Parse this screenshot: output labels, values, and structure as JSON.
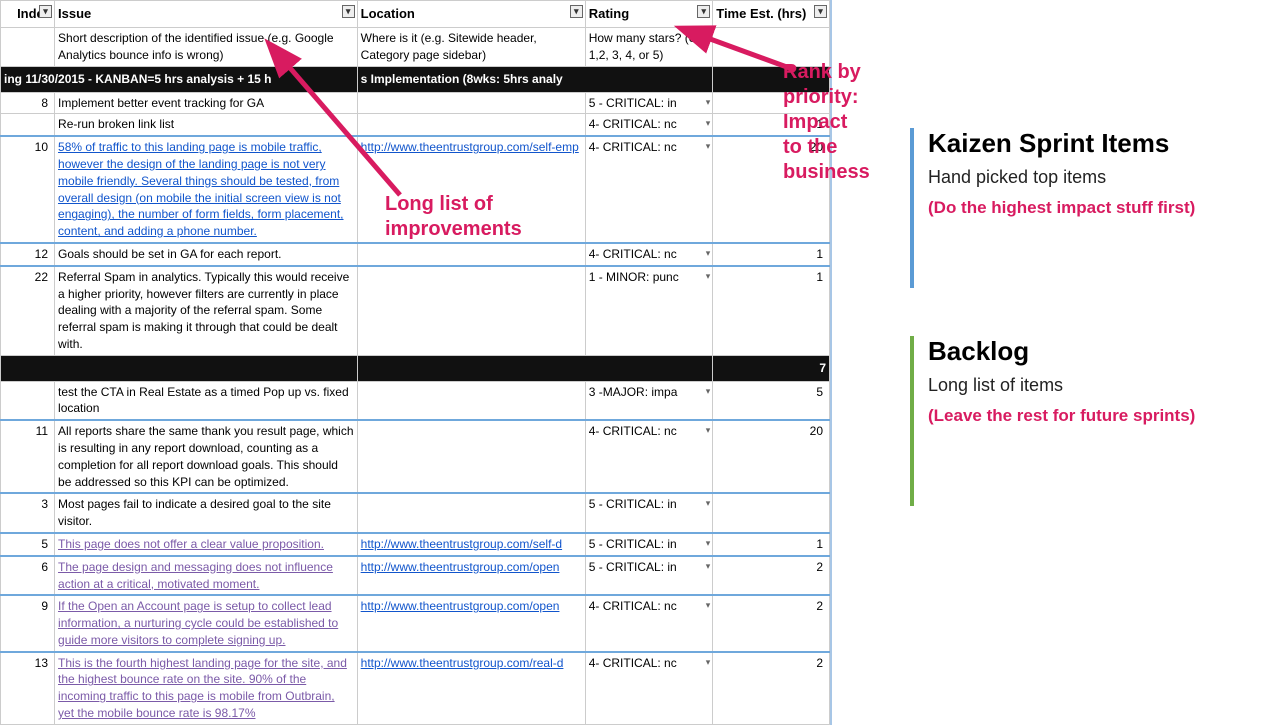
{
  "columns": {
    "index": "Index",
    "issue": "Issue",
    "location": "Location",
    "rating": "Rating",
    "time": "Time Est. (hrs)"
  },
  "hints": {
    "issue": "Short description of the identified issue (e.g. Google Analytics bounce info is wrong)",
    "location": "Where is it (e.g. Sitewide header, Category page sidebar)",
    "rating": "How many stars? (e.g. 1,2, 3, 4, or 5)"
  },
  "group1": {
    "header_left": "ing 11/30/2015 - KANBAN=5 hrs analysis + 15 h",
    "header_mid": "s Implementation (8wks: 5hrs analy",
    "rows": [
      {
        "index": "8",
        "issue": "Implement better event tracking for GA",
        "issue_link": false,
        "location": "",
        "rating": "5 - CRITICAL: in",
        "time": ""
      },
      {
        "index": "",
        "issue": "Re-run broken link list",
        "issue_link": false,
        "location": "",
        "rating": "4- CRITICAL: nc",
        "time": "1"
      },
      {
        "index": "10",
        "issue": "58% of traffic to this landing page is mobile traffic, however the design of the landing page is not very mobile friendly. Several things should be tested, from overall design (on mobile the initial screen view is not engaging), the number of form fields, form placement, content, and adding a phone number.",
        "issue_link": true,
        "location": "http://www.theentrustgroup.com/self-emp",
        "location_link": true,
        "rating": "4- CRITICAL: nc",
        "time": "20"
      },
      {
        "index": "12",
        "issue": "Goals should be set in GA for each report.",
        "issue_link": false,
        "location": "",
        "rating": "4- CRITICAL: nc",
        "time": "1"
      },
      {
        "index": "22",
        "issue": "Referral Spam in analytics. Typically this would receive a higher priority, however filters are currently in place dealing with a majority of the referral spam. Some referral spam is making it through that could be dealt with.",
        "issue_link": false,
        "location": "",
        "rating": "1 - MINOR: punc",
        "time": "1"
      }
    ]
  },
  "group2": {
    "total": "7",
    "rows": [
      {
        "index": "",
        "issue": "test the CTA in Real Estate as a timed Pop up vs. fixed location",
        "issue_link": false,
        "location": "",
        "rating": "3 -MAJOR: impa",
        "time": "5"
      },
      {
        "index": "11",
        "issue": "All reports share the same thank you result page, which is resulting in any report download, counting as a completion for all report download goals. This should be addressed so this KPI can be optimized.",
        "issue_link": false,
        "location": "",
        "rating": "4- CRITICAL: nc",
        "time": "20"
      },
      {
        "index": "3",
        "issue": "Most pages fail to indicate a desired goal to the site visitor.",
        "issue_link": false,
        "location": "",
        "rating": "5 - CRITICAL: in",
        "time": ""
      },
      {
        "index": "5",
        "issue": "This page does not offer a clear value proposition.",
        "issue_link": true,
        "link_class": "link-vis",
        "location": "http://www.theentrustgroup.com/self-d",
        "location_link": true,
        "rating": "5 - CRITICAL: in",
        "time": "1"
      },
      {
        "index": "6",
        "issue": "The page design and messaging does not influence action at a critical, motivated moment.",
        "issue_link": true,
        "link_class": "link-vis",
        "location": "http://www.theentrustgroup.com/open",
        "location_link": true,
        "rating": "5 - CRITICAL: in",
        "time": "2"
      },
      {
        "index": "9",
        "issue": "If the Open an Account page is setup to collect lead information, a nurturing cycle could be established to guide more visitors to complete signing up.",
        "issue_link": true,
        "link_class": "link-vis",
        "location": "http://www.theentrustgroup.com/open",
        "location_link": true,
        "rating": "4- CRITICAL: nc",
        "time": "2"
      },
      {
        "index": "13",
        "issue": "This is the fourth highest landing page for the site, and the highest bounce rate on the site. 90% of the incoming traffic to this page is mobile from Outbrain, yet the mobile bounce rate is 98.17%",
        "issue_link": true,
        "link_class": "link-vis",
        "location": "http://www.theentrustgroup.com/real-d",
        "location_link": true,
        "rating": "4- CRITICAL: nc",
        "time": "2"
      }
    ]
  },
  "callouts": {
    "rank1": "Rank by priority:",
    "rank2": "Impact to the business",
    "long": "Long list of improvements"
  },
  "right": {
    "k_title": "Kaizen Sprint Items",
    "k_sub": "Hand picked top items",
    "k_note": "(Do the highest impact stuff first)",
    "b_title": "Backlog",
    "b_sub": "Long list of items",
    "b_note": "(Leave the rest for future sprints)"
  }
}
